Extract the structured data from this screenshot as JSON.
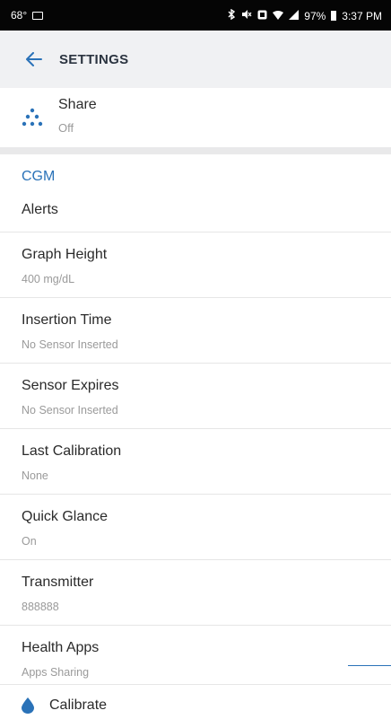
{
  "status_bar": {
    "temperature": "68°",
    "battery_percent": "97%",
    "time": "3:37 PM"
  },
  "header": {
    "back_icon": "arrow-left-icon",
    "title": "SETTINGS"
  },
  "share": {
    "icon": "share-dots-icon",
    "label": "Share",
    "value": "Off"
  },
  "section": {
    "title": "CGM",
    "alerts_label": "Alerts"
  },
  "settings": [
    {
      "label": "Graph Height",
      "value": "400 mg/dL"
    },
    {
      "label": "Insertion Time",
      "value": "No Sensor Inserted"
    },
    {
      "label": "Sensor Expires",
      "value": "No Sensor Inserted"
    },
    {
      "label": "Last Calibration",
      "value": "None"
    },
    {
      "label": "Quick Glance",
      "value": "On"
    },
    {
      "label": "Transmitter",
      "value": "888888"
    },
    {
      "label": "Health Apps",
      "value": "Apps Sharing"
    }
  ],
  "calibrate": {
    "icon": "drop-icon",
    "label": "Calibrate"
  },
  "colors": {
    "accent": "#2a72b8",
    "statusbar": "#050505",
    "appbar": "#f0f1f3"
  }
}
